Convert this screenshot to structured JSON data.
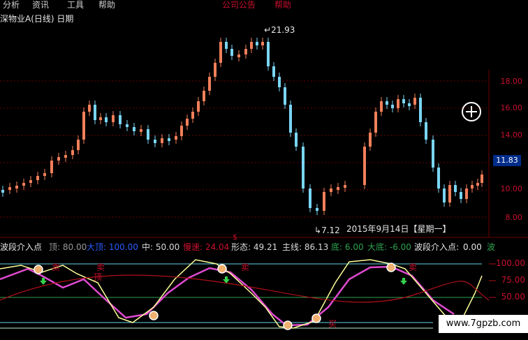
{
  "menu": {
    "items": [
      "分析",
      "资讯",
      "工具",
      "帮助"
    ],
    "right_items": [
      "公司公告",
      "帮助"
    ]
  },
  "chart_title": "深物业A(日线) 日期",
  "price_axis": {
    "labels": [
      "18.00",
      "16.00",
      "14.00",
      "10.00",
      "8.00"
    ],
    "current_price": "11.83"
  },
  "annotations": {
    "high": "21.93",
    "low": "7.12",
    "date": "2015年9月14日【星期一】",
    "dollar": "$"
  },
  "indicator": {
    "name": "波段介入点",
    "items": [
      {
        "label": "顶:",
        "value": "80.00",
        "color": "#9a9a9a"
      },
      {
        "label": "大顶:",
        "value": "100.00",
        "color": "#2b5cff"
      },
      {
        "label": "中:",
        "value": "50.00",
        "color": "#d9d9d9"
      },
      {
        "label": "慢速:",
        "value": "24.04",
        "color": "#c8102e"
      },
      {
        "label": "形态:",
        "value": "49.21",
        "color": "#d9d9d9"
      },
      {
        "label": "主线:",
        "value": "86.13",
        "color": "#d9d9d9"
      },
      {
        "label": "底:",
        "value": "6.00",
        "color": "#2ea44f"
      },
      {
        "label": "大底:",
        "value": "-6.00",
        "color": "#2ea44f"
      }
    ],
    "right_name": "波段介入点:",
    "right_value": "0.00",
    "right_suffix": "波"
  },
  "osc_axis": [
    "100.00",
    "75.00",
    "50.00"
  ],
  "osc_signals": {
    "sell": "卖",
    "top": "顶",
    "buy": "买"
  },
  "watermark": "www.7gpzb.com",
  "colors": {
    "up": "#f2805a",
    "down": "#7ad6f5",
    "magenta": "#e04ad0",
    "yellow": "#ffff99",
    "redline": "#b0101a",
    "grid": "#6b0000"
  }
}
